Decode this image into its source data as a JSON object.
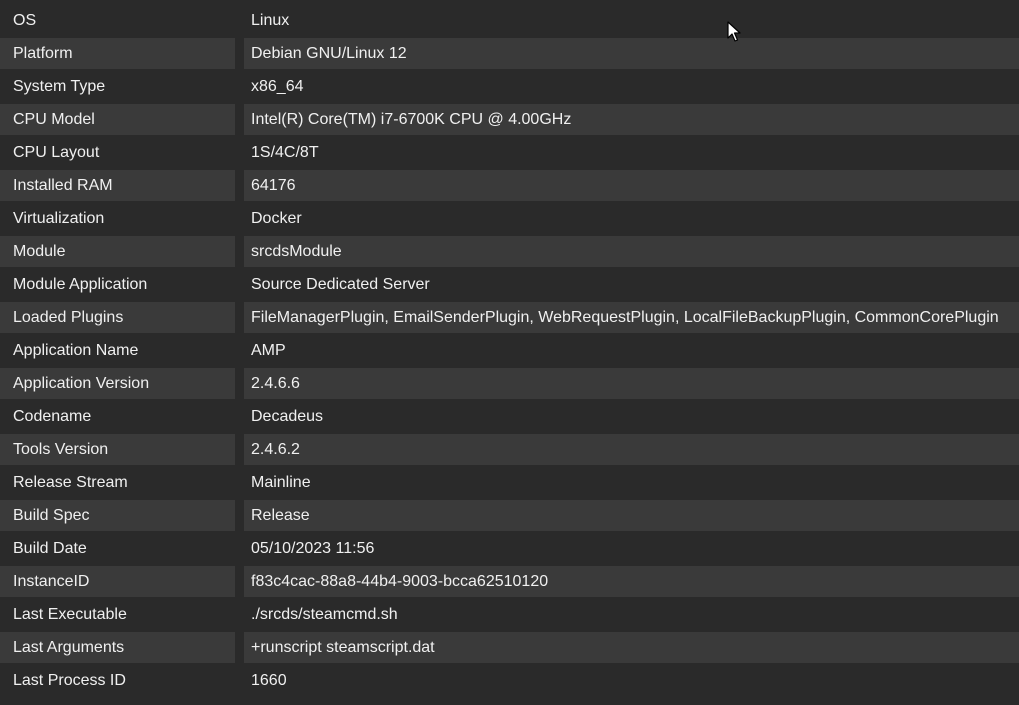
{
  "rows": [
    {
      "key": "OS",
      "value": "Linux"
    },
    {
      "key": "Platform",
      "value": "Debian GNU/Linux 12"
    },
    {
      "key": "System Type",
      "value": "x86_64"
    },
    {
      "key": "CPU Model",
      "value": "Intel(R) Core(TM) i7-6700K CPU @ 4.00GHz"
    },
    {
      "key": "CPU Layout",
      "value": "1S/4C/8T"
    },
    {
      "key": "Installed RAM",
      "value": "64176"
    },
    {
      "key": "Virtualization",
      "value": "Docker"
    },
    {
      "key": "Module",
      "value": "srcdsModule"
    },
    {
      "key": "Module Application",
      "value": "Source Dedicated Server"
    },
    {
      "key": "Loaded Plugins",
      "value": "FileManagerPlugin, EmailSenderPlugin, WebRequestPlugin, LocalFileBackupPlugin, CommonCorePlugin"
    },
    {
      "key": "Application Name",
      "value": "AMP"
    },
    {
      "key": "Application Version",
      "value": "2.4.6.6"
    },
    {
      "key": "Codename",
      "value": "Decadeus"
    },
    {
      "key": "Tools Version",
      "value": "2.4.6.2"
    },
    {
      "key": "Release Stream",
      "value": "Mainline"
    },
    {
      "key": "Build Spec",
      "value": "Release"
    },
    {
      "key": "Build Date",
      "value": "05/10/2023 11:56"
    },
    {
      "key": "InstanceID",
      "value": "f83c4cac-88a8-44b4-9003-bcca62510120"
    },
    {
      "key": "Last Executable",
      "value": "./srcds/steamcmd.sh"
    },
    {
      "key": "Last Arguments",
      "value": "+runscript steamscript.dat"
    },
    {
      "key": "Last Process ID",
      "value": "1660"
    }
  ],
  "colors": {
    "background": "#2a2a2a",
    "row_alt": "#3a3a3a",
    "text": "#f0f0f0"
  },
  "icons": {
    "cursor": "mouse-pointer-icon"
  }
}
